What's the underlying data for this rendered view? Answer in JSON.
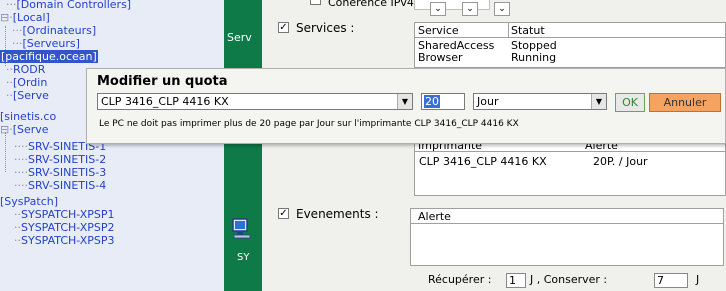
{
  "tree": {
    "rows": [
      {
        "lead": "···",
        "text": "[Domain Controllers]"
      },
      {
        "lead": "⊟·",
        "text": "[Local]"
      },
      {
        "lead": "···",
        "text": "[Ordinateurs]"
      },
      {
        "lead": "···",
        "text": "[Serveurs]"
      },
      {
        "lead": "",
        "text": "[pacifique.ocean]"
      },
      {
        "lead": "··",
        "text": "RODR"
      },
      {
        "lead": "··",
        "text": "[Ordin"
      },
      {
        "lead": "··",
        "text": "[Serve"
      },
      {
        "lead": "",
        "text": "[sinetis.co"
      },
      {
        "lead": "⊟·",
        "text": "[Serve"
      },
      {
        "lead": "····",
        "text": "SRV-SINETIS-1"
      },
      {
        "lead": "····",
        "text": "SRV-SINETIS-2"
      },
      {
        "lead": "····",
        "text": "SRV-SINETIS-3"
      },
      {
        "lead": "····",
        "text": "SRV-SINETIS-4"
      },
      {
        "lead": "",
        "text": "[SysPatch]"
      },
      {
        "lead": "··",
        "text": "SYSPATCH-XPSP1"
      },
      {
        "lead": "··",
        "text": "SYSPATCH-XPSP2"
      },
      {
        "lead": "··",
        "text": "SYSPATCH-XPSP3"
      }
    ]
  },
  "green": {
    "label_top": "Serv",
    "label_bottom": "SY"
  },
  "panel": {
    "coherence_label": "Coherence IPv4 :",
    "services_label": "Services :",
    "services_checked": "✓",
    "services_table": {
      "headers": [
        "Service",
        "Statut"
      ],
      "rows": [
        [
          "SharedAccess",
          "Stopped"
        ],
        [
          "Browser",
          "Running"
        ]
      ]
    },
    "quota_table": {
      "headers": [
        "Imprimante",
        "Alerte"
      ],
      "rows": [
        [
          "CLP 3416_CLP 4416 KX",
          "20P. / Jour"
        ]
      ]
    },
    "evenements_label": "Evenements :",
    "evenements_checked": "✓",
    "alert_header": "Alerte",
    "recuperer_label": "Récupérer :",
    "recuperer_value": "1",
    "unit_j_1": "J , Conserver :",
    "conserver_value": "7",
    "unit_j_2": "J"
  },
  "dialog": {
    "title": "Modifier un quota",
    "printer_value": "CLP 3416_CLP 4416 KX",
    "quantity_value": "20",
    "period_value": "Jour",
    "ok_label": "OK",
    "cancel_label": "Annuler",
    "message": "Le PC ne doit pas imprimer plus de 20 page par Jour sur l'imprimante CLP 3416_CLP 4416 KX"
  },
  "colors": {
    "tree_bg": "#e8ecf7",
    "tree_text": "#2442c8",
    "green_band": "#0d7a47",
    "cancel_button": "#f4a460",
    "selection": "#3a6fd8"
  }
}
